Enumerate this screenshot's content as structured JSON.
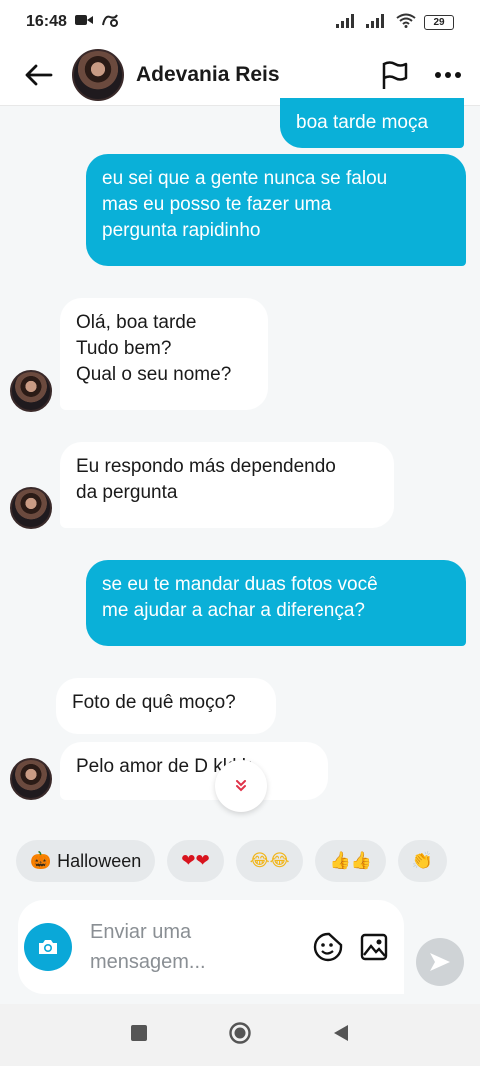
{
  "status_bar": {
    "time": "16:48",
    "battery": "29"
  },
  "header": {
    "contact_name": "Adevania Reis",
    "back_icon": "arrow-left-icon",
    "flag_icon": "flag-icon",
    "more_icon": "more-dots-icon"
  },
  "messages": [
    {
      "from": "me",
      "text": "boa tarde moça"
    },
    {
      "from": "me",
      "text": "eu sei que a gente nunca se falou\nmas eu posso te fazer uma\npergunta rapidinho"
    },
    {
      "from": "them",
      "text": "Olá, boa tarde\nTudo bem?\nQual o seu nome?"
    },
    {
      "from": "them",
      "text": "Eu respondo más dependendo\nda pergunta"
    },
    {
      "from": "me",
      "text": "se eu te mandar duas fotos você\nme ajudar a achar a diferença?"
    },
    {
      "from": "them",
      "text": "Foto de quê moço?"
    },
    {
      "from": "them",
      "text": "Pelo amor de D    kkkk"
    }
  ],
  "chips": [
    {
      "emoji": "🎃",
      "label": "Halloween"
    },
    {
      "emoji": "❤❤",
      "label": ""
    },
    {
      "emoji": "😂😂",
      "label": ""
    },
    {
      "emoji": "👍👍",
      "label": ""
    },
    {
      "emoji": "👏",
      "label": ""
    }
  ],
  "composer": {
    "placeholder": "Enviar uma\nmensagem..."
  },
  "colors": {
    "accent": "#0ab0d8",
    "bubble_in": "#ffffff",
    "background": "#f5f7f8"
  }
}
